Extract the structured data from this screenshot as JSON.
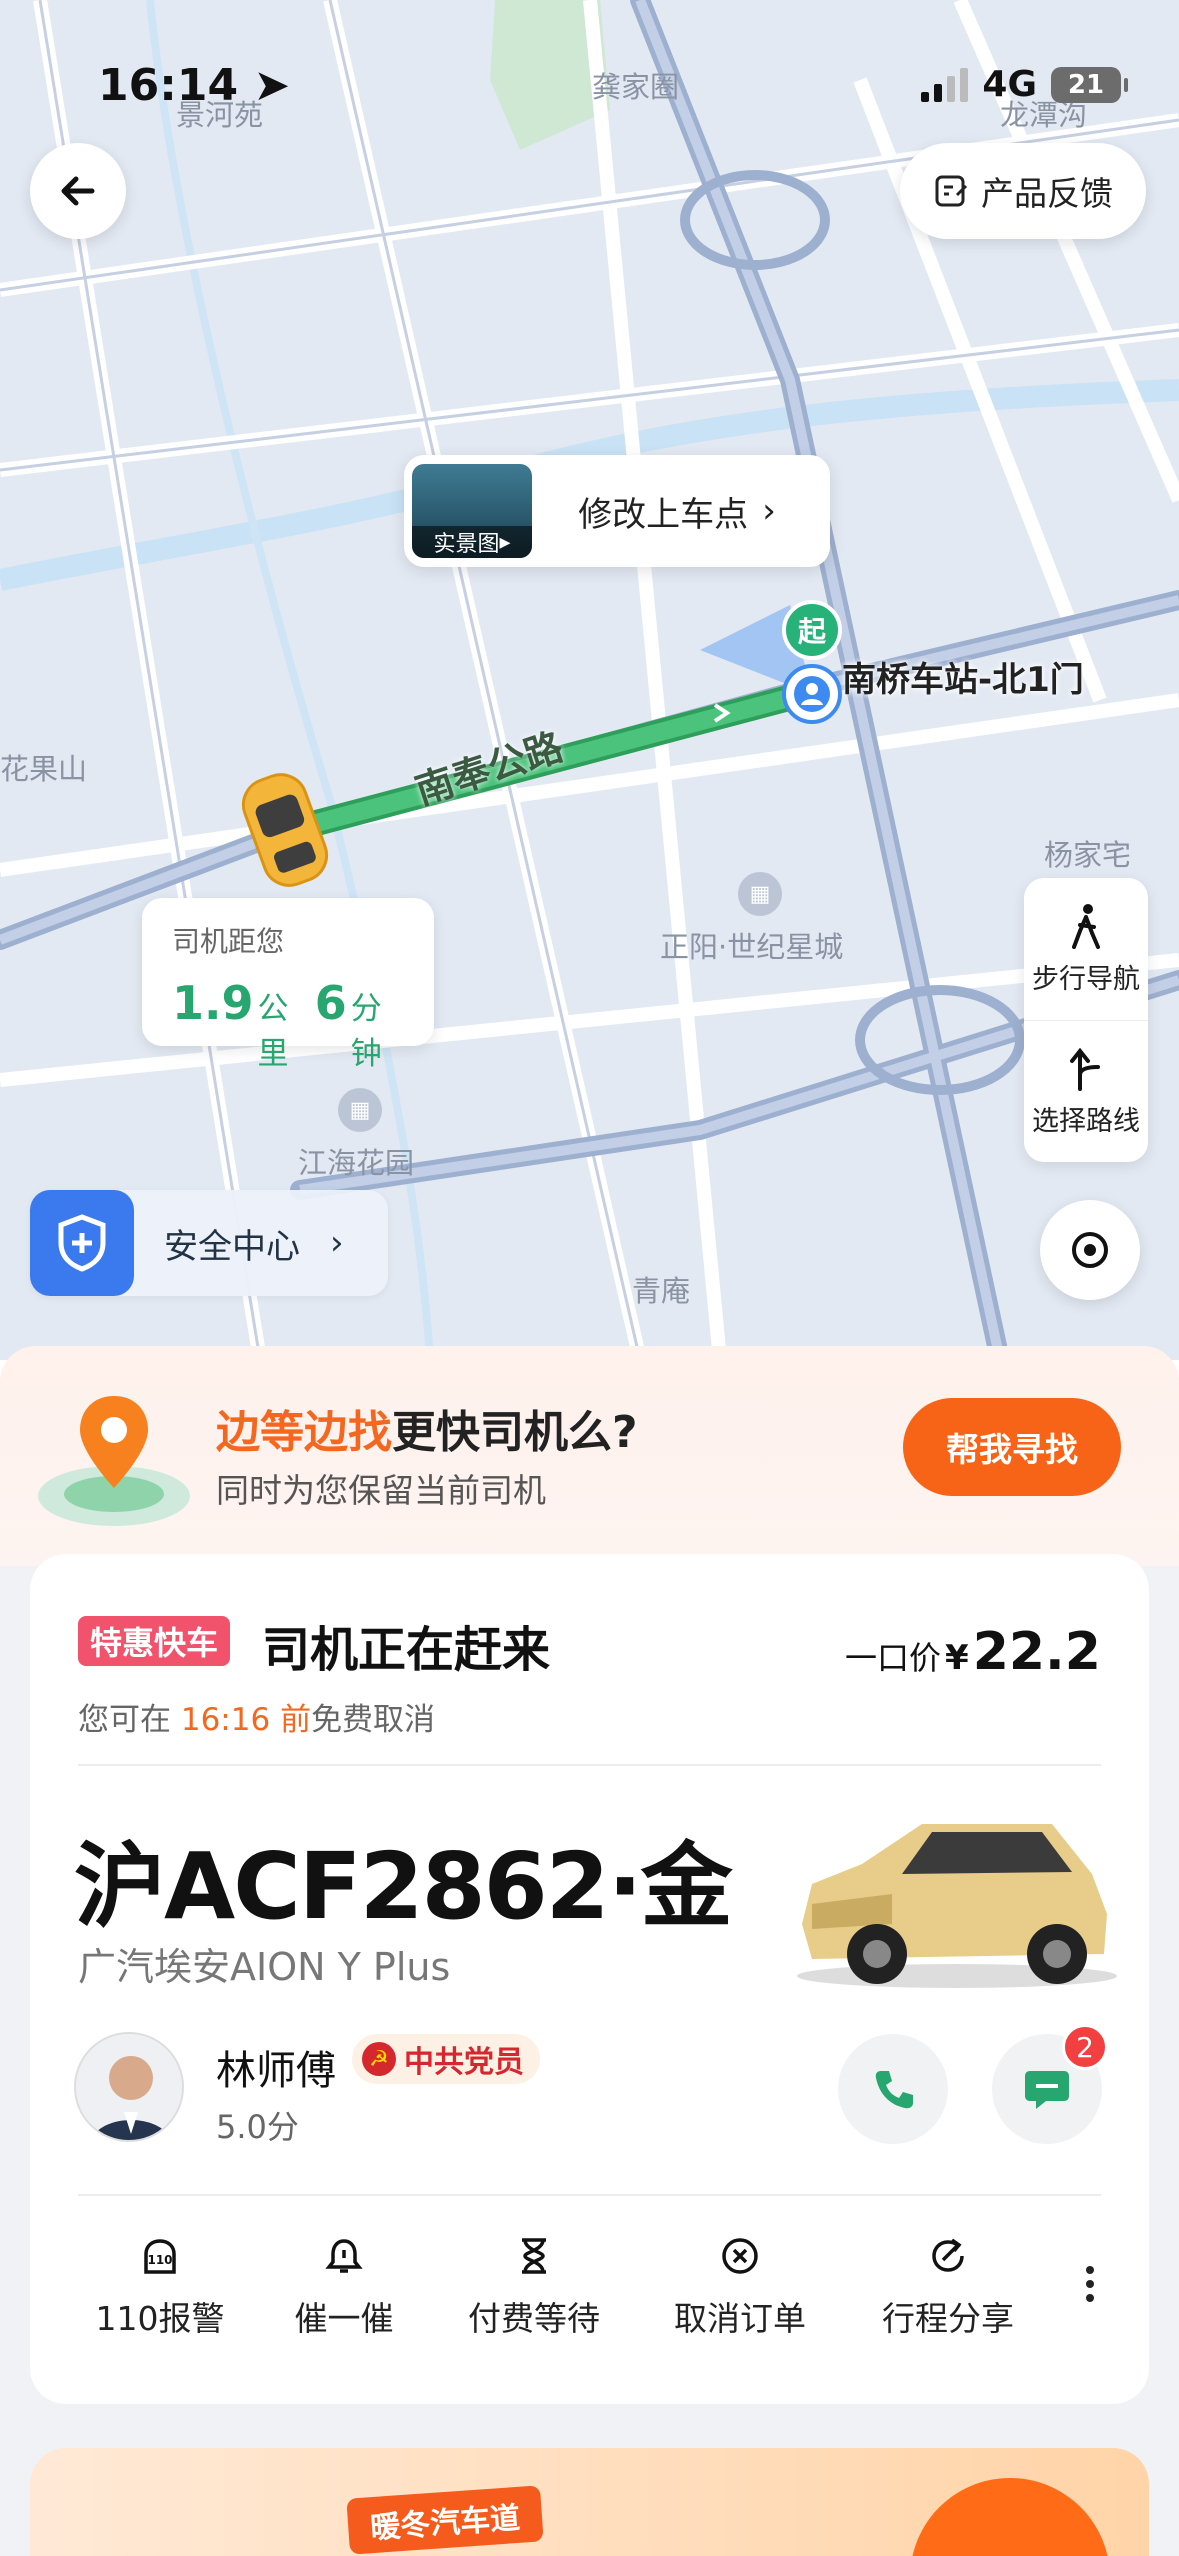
{
  "status_bar": {
    "time": "16:14",
    "network": "4G",
    "battery": "21"
  },
  "header": {
    "feedback_label": "产品反馈"
  },
  "map": {
    "labels": {
      "jinghe": "景河苑",
      "gongjiaquan": "龚家圈",
      "longtan": "龙潭沟",
      "huaguoshan": "花果山",
      "yangjiazhai": "杨家宅",
      "zhengyang": "正阳·世纪星城",
      "jianghai": "江海花园",
      "qingan": "青庵"
    },
    "road_name": "南奉公路",
    "station": "南桥车站-北1门",
    "start_marker": "起",
    "pickup_card": {
      "thumb_label": "实景图",
      "text": "修改上车点"
    },
    "eta": {
      "title": "司机距您",
      "distance": "1.9",
      "distance_unit": "公里",
      "minutes": "6",
      "minutes_unit": "分钟"
    },
    "side_tools": {
      "walk": "步行导航",
      "route": "选择路线"
    },
    "safety_center": "安全中心"
  },
  "promo": {
    "title_highlight": "边等边找",
    "title_rest": "更快司机么?",
    "subtitle": "同时为您保留当前司机",
    "button": "帮我寻找"
  },
  "order": {
    "tag": "特惠快车",
    "status": "司机正在赶来",
    "cancel_prefix": "您可在",
    "cancel_time": "16:16",
    "cancel_mid": "前",
    "cancel_suffix": "免费取消",
    "price_label": "一口价",
    "price_symbol": "¥",
    "price": "22.2",
    "plate": "沪ACF2862·金",
    "car_model": "广汽埃安AION Y Plus",
    "driver_name": "林师傅",
    "party_badge": "中共党员",
    "rating": "5.0分",
    "unread_messages": "2"
  },
  "actions": [
    {
      "label": "110报警",
      "icon": "police-110-icon"
    },
    {
      "label": "催一催",
      "icon": "bell-icon"
    },
    {
      "label": "付费等待",
      "icon": "hourglass-icon"
    },
    {
      "label": "取消订单",
      "icon": "cancel-circle-icon"
    },
    {
      "label": "行程分享",
      "icon": "share-icon"
    }
  ],
  "ad": {
    "tag": "暖冬汽车道"
  },
  "colors": {
    "accent_orange": "#f86417",
    "route_green": "#3fbe71",
    "tag_red": "#f2536c",
    "safety_blue": "#3a79ee"
  }
}
